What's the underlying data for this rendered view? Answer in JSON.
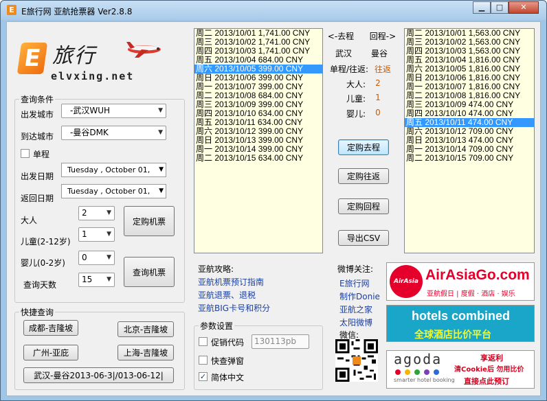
{
  "window": {
    "title": "E旅行网 亚航抢票器   Ver2.8.8",
    "min_glyph": "▁",
    "max_glyph": "□",
    "close_glyph": "✕"
  },
  "logo": {
    "letter": "E",
    "cn": "旅行",
    "en": "elvxing.net"
  },
  "query": {
    "legend": "查询条件",
    "depart_city_label": "出发城市",
    "depart_city_value": "-武汉WUH",
    "arrive_city_label": "到达城市",
    "arrive_city_value": "-曼谷DMK",
    "oneway_label": "单程",
    "depart_date_label": "出发日期",
    "depart_date_value": "Tuesday  ,  October  01, ",
    "return_date_label": "返回日期",
    "return_date_value": "Tuesday  ,  October  01, ",
    "adult_label": "大人",
    "adult_value": "2",
    "child_label": "儿童(2-12岁)",
    "child_value": "1",
    "infant_label": "婴儿(0-2岁)",
    "infant_value": "0",
    "days_label": "查询天数",
    "days_value": "15",
    "book_button": "定购机票",
    "search_button": "查询机票"
  },
  "quick": {
    "legend": "快捷查询",
    "btn1": "成都-吉隆坡",
    "btn2": "北京-吉隆坡",
    "btn3": "广州-亚庇",
    "btn4": "上海-吉隆坡",
    "btn5": "武汉-曼谷2013-06-3|/013-06-12|"
  },
  "outbound": [
    "周二 2013/10/01 1,741.00 CNY",
    "周三 2013/10/02 1,741.00 CNY",
    "周四 2013/10/03 1,741.00 CNY",
    "周五 2013/10/04 684.00 CNY",
    "周六 2013/10/05 399.00 CNY",
    "周日 2013/10/06 399.00 CNY",
    "周一 2013/10/07 399.00 CNY",
    "周二 2013/10/08 684.00 CNY",
    "周三 2013/10/09 399.00 CNY",
    "周四 2013/10/10 634.00 CNY",
    "周五 2013/10/11 634.00 CNY",
    "周六 2013/10/12 399.00 CNY",
    "周日 2013/10/13 399.00 CNY",
    "周一 2013/10/14 399.00 CNY",
    "周二 2013/10/15 634.00 CNY"
  ],
  "outbound_selected": 4,
  "return": [
    "周二 2013/10/01 1,563.00 CNY",
    "周三 2013/10/02 1,563.00 CNY",
    "周四 2013/10/03 1,563.00 CNY",
    "周五 2013/10/04 1,816.00 CNY",
    "周六 2013/10/05 1,816.00 CNY",
    "周日 2013/10/06 1,816.00 CNY",
    "周一 2013/10/07 1,816.00 CNY",
    "周二 2013/10/08 1,816.00 CNY",
    "周三 2013/10/09 474.00 CNY",
    "周四 2013/10/10 474.00 CNY",
    "周五 2013/10/11 474.00 CNY",
    "周六 2013/10/12 709.00 CNY",
    "周日 2013/10/13 474.00 CNY",
    "周一 2013/10/14 709.00 CNY",
    "周二 2013/10/15 709.00 CNY"
  ],
  "return_selected": 10,
  "middle": {
    "go_header": "<-去程",
    "back_header": "回程->",
    "from_city": "武汉",
    "to_city": "曼谷",
    "trip_label": "单程/往返:",
    "trip_value": "往返",
    "adult_label": "大人:",
    "adult_value": "2",
    "child_label": "儿童:",
    "child_value": "1",
    "infant_label": "婴儿:",
    "infant_value": "0",
    "book_go": "定购去程",
    "book_round": "定购往返",
    "book_back": "定购回程",
    "export": "导出CSV"
  },
  "guide": {
    "title": "亚航攻略:",
    "link1": "亚航机票预订指南",
    "link2": "亚航退票、退税",
    "link3": "亚航BIG卡号和积分"
  },
  "settings": {
    "legend": "参数设置",
    "promo_label": "促销代码",
    "promo_value": "130113pb",
    "popup_label": "快查弹窗",
    "chinese_label": "简体中文",
    "check_glyph": "✓"
  },
  "weibo": {
    "title": "微博关注:",
    "link1": "E旅行网",
    "link2": "制作Donie",
    "link3": "亚航之家",
    "link4": "太阳微博",
    "wechat": "微信:"
  },
  "ads": {
    "airasia_main": "AirAsiaGo.com",
    "airasia_logo": "AirAsia",
    "airasia_sub": "亚航假日 | 度假 · 酒店 · 娱乐",
    "hotels_main": "hotels combined",
    "hotels_sub": "全球酒店比价平台",
    "agoda_main": "agoda",
    "agoda_tag": "smarter hotel booking",
    "agoda_line1": "享返利",
    "agoda_line2": "清Cookie后  勿用比价",
    "agoda_line3": "直接点此预订"
  },
  "colors": {
    "list_bg": "#ffffe1",
    "selection": "#3399ff",
    "airasia_red": "#e4002b",
    "hotels_teal": "#1aa6c9"
  }
}
